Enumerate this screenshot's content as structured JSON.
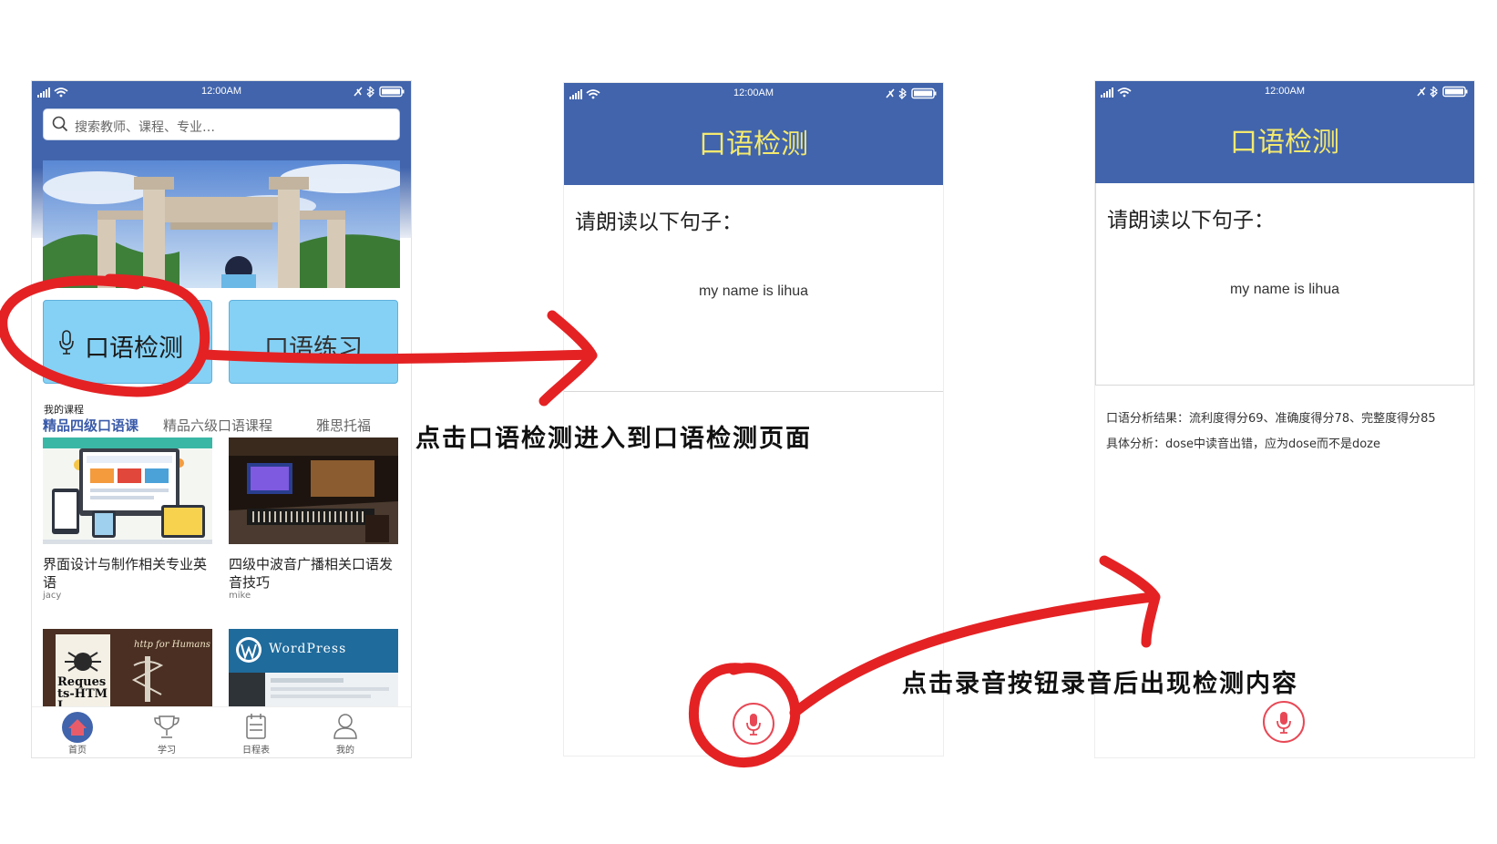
{
  "colors": {
    "brand_blue": "#4164ac",
    "title_yellow": "#f4e96e",
    "tile_blue": "#85d1f5",
    "active_tab": "#3a5ba9",
    "record_red": "#e84855",
    "annotation_red": "#e42224"
  },
  "status_bar": {
    "time": "12:00AM"
  },
  "screen1": {
    "search": {
      "placeholder": "搜索教师、课程、专业…",
      "icon": "search-icon"
    },
    "tiles": [
      {
        "label": "口语检测",
        "icon": "microphone-icon"
      },
      {
        "label": "口语练习"
      }
    ],
    "section_label": "我的课程",
    "course_tabs": [
      {
        "label": "精品四级口语课",
        "active": true
      },
      {
        "label": "精品六级口语课程",
        "active": false
      },
      {
        "label": "雅思托福",
        "active": false
      }
    ],
    "courses": [
      {
        "title": "界面设计与制作相关专业英语",
        "author": "jacy"
      },
      {
        "title": "四级中波音广播相关口语发音技巧",
        "author": "mike"
      },
      {
        "title": "",
        "author": "",
        "image_text": "Requests-HTML",
        "image_subtext": "http for Humans"
      },
      {
        "title": "",
        "author": "",
        "image_text": "WordPress"
      }
    ],
    "tabbar": [
      {
        "label": "首页",
        "icon": "home-icon",
        "active": true
      },
      {
        "label": "学习",
        "icon": "trophy-icon",
        "active": false
      },
      {
        "label": "日程表",
        "icon": "calendar-icon",
        "active": false
      },
      {
        "label": "我的",
        "icon": "user-icon",
        "active": false
      }
    ]
  },
  "screen2": {
    "title": "口语检测",
    "prompt": "请朗读以下句子：",
    "sentence": "my name is lihua",
    "record_icon": "microphone-icon"
  },
  "screen3": {
    "title": "口语检测",
    "prompt": "请朗读以下句子：",
    "sentence": "my name is lihua",
    "result_summary": "口语分析结果：流利度得分69、准确度得分78、完整度得分85",
    "result_detail": "具体分析：dose中读音出错，应为dose而不是doze",
    "record_icon": "microphone-icon"
  },
  "annotations": {
    "step1": "点击口语检测进入到口语检测页面",
    "step2": "点击录音按钮录音后出现检测内容"
  }
}
